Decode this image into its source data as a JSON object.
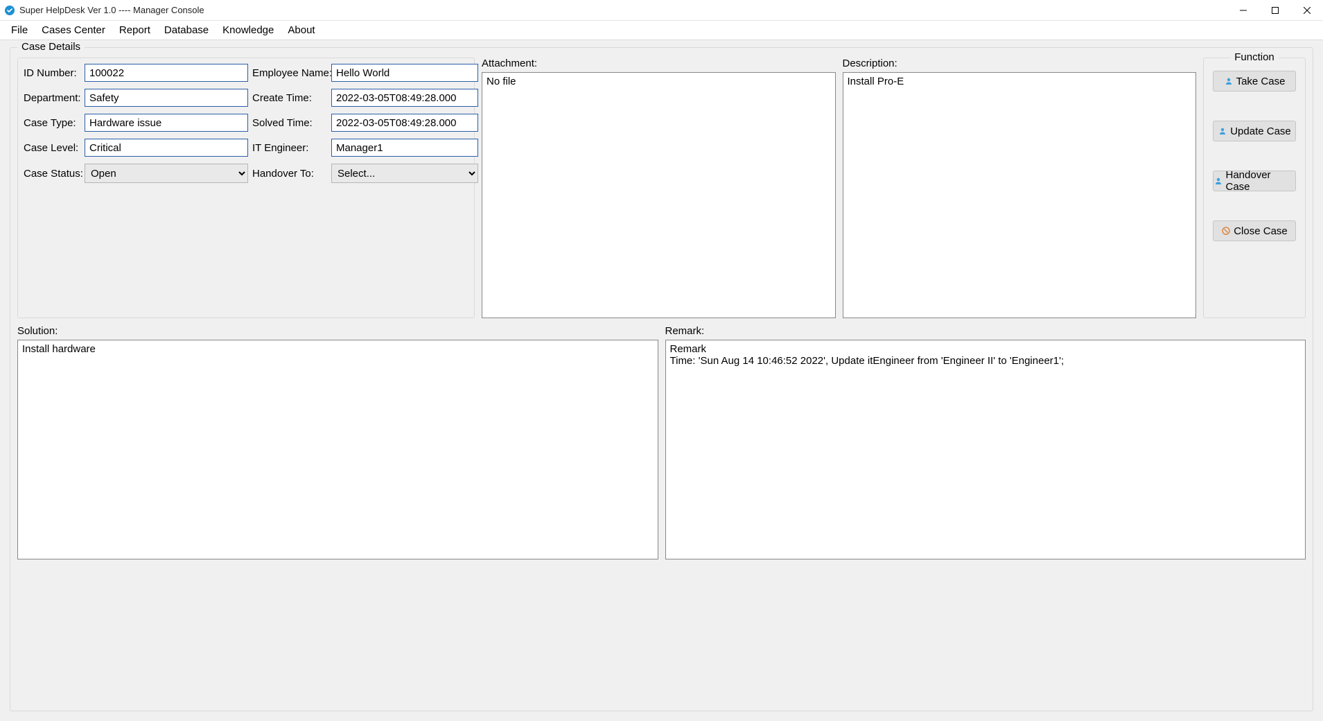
{
  "window": {
    "title": "Super HelpDesk Ver 1.0  ---- Manager Console"
  },
  "menubar": {
    "file": "File",
    "cases_center": "Cases Center",
    "report": "Report",
    "database": "Database",
    "knowledge": "Knowledge",
    "about": "About"
  },
  "case_details": {
    "title": "Case Details",
    "labels": {
      "id_number": "ID Number:",
      "employee_name": "Employee Name:",
      "department": "Department:",
      "create_time": "Create Time:",
      "case_type": "Case Type:",
      "solved_time": "Solved Time:",
      "case_level": "Case Level:",
      "it_engineer": "IT Engineer:",
      "case_status": "Case Status:",
      "handover_to": "Handover To:",
      "attachment": "Attachment:",
      "description": "Description:"
    },
    "values": {
      "id_number": "100022",
      "employee_name": "Hello World",
      "department": "Safety",
      "create_time": "2022-03-05T08:49:28.000",
      "case_type": "Hardware issue",
      "solved_time": "2022-03-05T08:49:28.000",
      "case_level": "Critical",
      "it_engineer": "Manager1",
      "case_status": "Open",
      "handover_to": "Select...",
      "attachment": "No file",
      "description": "Install Pro-E"
    }
  },
  "function": {
    "title": "Function",
    "take_case": "Take Case",
    "update_case": "Update Case",
    "handover_case": "Handover Case",
    "close_case": "Close Case"
  },
  "solution": {
    "label": "Solution:",
    "value": "Install hardware"
  },
  "remark": {
    "label": "Remark:",
    "value": "Remark\nTime: 'Sun Aug 14 10:46:52 2022', Update itEngineer from 'Engineer II' to 'Engineer1';"
  }
}
